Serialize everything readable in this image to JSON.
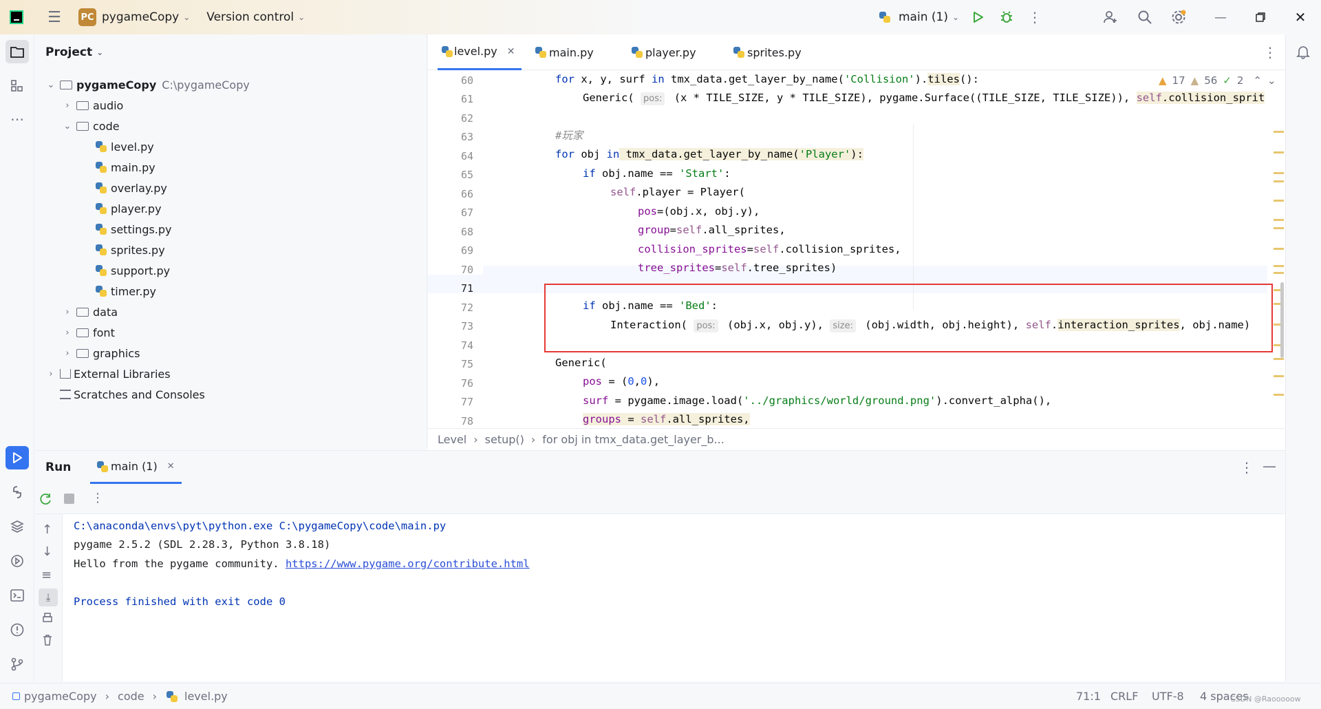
{
  "titlebar": {
    "project_badge": "PC",
    "project_name": "pygameCopy",
    "vcs": "Version control",
    "run_config": "main (1)"
  },
  "project_panel": {
    "title": "Project",
    "root": {
      "name": "pygameCopy",
      "path": "C:\\pygameCopy"
    },
    "items": [
      {
        "label": "audio"
      },
      {
        "label": "code"
      },
      {
        "label": "level.py"
      },
      {
        "label": "main.py"
      },
      {
        "label": "overlay.py"
      },
      {
        "label": "player.py"
      },
      {
        "label": "settings.py"
      },
      {
        "label": "sprites.py"
      },
      {
        "label": "support.py"
      },
      {
        "label": "timer.py"
      },
      {
        "label": "data"
      },
      {
        "label": "font"
      },
      {
        "label": "graphics"
      },
      {
        "label": "External Libraries"
      },
      {
        "label": "Scratches and Consoles"
      }
    ]
  },
  "tabs": [
    "level.py",
    "main.py",
    "player.py",
    "sprites.py"
  ],
  "inspections": {
    "warnings": "17",
    "weak": "56",
    "ok": "2"
  },
  "line_numbers": [
    "60",
    "61",
    "62",
    "63",
    "64",
    "65",
    "66",
    "67",
    "68",
    "69",
    "70",
    "71",
    "72",
    "73",
    "74",
    "75",
    "76",
    "77",
    "78"
  ],
  "code": {
    "l60": [
      "for",
      " x, y, surf ",
      "in",
      " tmx_data.get_layer_by_name(",
      "'Collision'",
      ").",
      "tiles",
      "():"
    ],
    "l61": [
      "Generic(",
      "pos:",
      " (x * TILE_SIZE, y * TILE_SIZE), pygame.Surface((TILE_SIZE, TILE_SIZE)), ",
      "self",
      ".collision_sprit"
    ],
    "l63": "#玩家",
    "l64": [
      "for",
      " obj ",
      "in",
      " tmx_data.get_layer_by_name(",
      "'Player'",
      "):"
    ],
    "l65": [
      "if",
      " obj.name == ",
      "'Start'",
      ":"
    ],
    "l66": [
      "self",
      ".player = Player("
    ],
    "l67": [
      "pos",
      "=(obj.x, obj.y),"
    ],
    "l68": [
      "group",
      "=",
      "self",
      ".all_sprites,"
    ],
    "l69": [
      "collision_sprites",
      "=",
      "self",
      ".collision_sprites,"
    ],
    "l70": [
      "tree_sprites",
      "=",
      "self",
      ".tree_sprites)"
    ],
    "l72": [
      "if",
      " obj.name == ",
      "'Bed'",
      ":"
    ],
    "l73": [
      "Interaction(",
      "pos:",
      " (obj.x, obj.y), ",
      "size:",
      " (obj.width, obj.height), ",
      "self",
      ".",
      "interaction_sprites",
      ", obj.name)"
    ],
    "l75": "Generic(",
    "l76": [
      "pos",
      " = (",
      "0",
      ",",
      "0",
      "),"
    ],
    "l77": [
      "surf",
      " = pygame.image.load(",
      "'../graphics/world/ground.png'",
      ").convert_alpha(),"
    ],
    "l78": [
      "groups",
      " = ",
      "self",
      ".all_sprites,"
    ]
  },
  "breadcrumb": [
    "Level",
    "setup()",
    "for obj in tmx_data.get_layer_b..."
  ],
  "run": {
    "title": "Run",
    "tab": "main (1)",
    "output": [
      "C:\\anaconda\\envs\\pyt\\python.exe C:\\pygameCopy\\code\\main.py",
      "pygame 2.5.2 (SDL 2.28.3, Python 3.8.18)",
      "Hello from the pygame community. ",
      "https://www.pygame.org/contribute.html",
      "Process finished with exit code 0"
    ]
  },
  "statusbar": {
    "crumbs": [
      "pygameCopy",
      "code",
      "level.py"
    ],
    "position": "71:1",
    "line_sep": "CRLF",
    "encoding": "UTF-8",
    "indent": "4 spaces",
    "watermark": "CSDN @Raooooow"
  },
  "colors": {
    "accent": "#3574f0",
    "red_box": "#e53935",
    "run_green": "#3fa83f"
  }
}
